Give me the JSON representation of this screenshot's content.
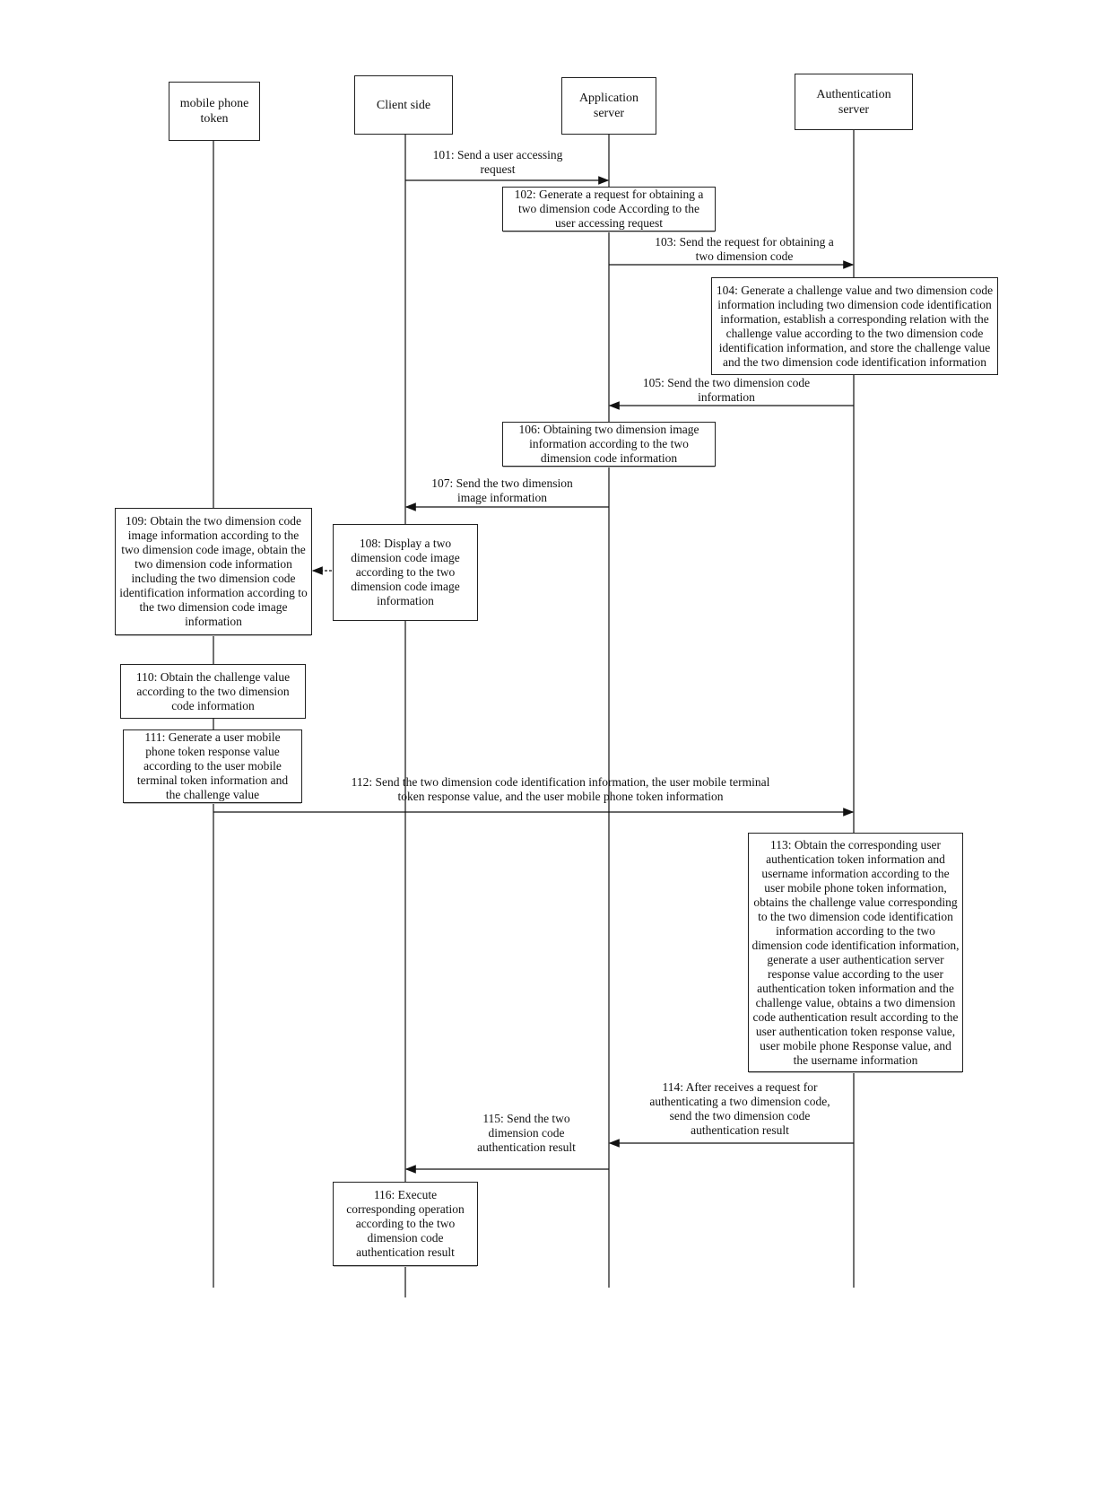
{
  "actors": [
    {
      "id": "token",
      "label": "mobile phone token"
    },
    {
      "id": "client",
      "label": "Client side"
    },
    {
      "id": "app",
      "label": "Application server"
    },
    {
      "id": "auth",
      "label": "Authentication server"
    }
  ],
  "messages": {
    "m101": "101:  Send a user accessing request",
    "m103": "103:  Send the request for obtaining a two dimension code",
    "m105": "105:  Send the two dimension code information",
    "m107": "107:  Send the two dimension image information",
    "m112": "112:  Send the two dimension code identification information, the user mobile terminal token response value, and the user mobile phone token information",
    "m114": "114:  After receives a request for authenticating a two dimension code, send the two dimension code authentication result",
    "m115": "115:  Send the two dimension code authentication result"
  },
  "steps": {
    "s102": "102:  Generate a request for obtaining a two dimension code According to the user accessing request",
    "s104": "104: Generate a challenge value and two dimension code information including two dimension code identification information, establish a corresponding relation with the challenge value according to the two dimension code identification information, and store the challenge value and the two dimension code identification information",
    "s106": "106:  Obtaining two dimension image information according to the two dimension code information",
    "s108": "108:  Display a two dimension code image according to the two dimension code image information",
    "s109": "109: Obtain the two dimension code image information according to the two dimension code image, obtain the two dimension code information including the two dimension code identification information according to the two dimension code image information",
    "s110": "110:  Obtain the challenge value according to the two dimension code information",
    "s111": "111: Generate a user mobile phone token response value according to the user mobile terminal token information and the challenge value",
    "s113": "113:  Obtain the corresponding user authentication token information and username information according to the user mobile phone token information, obtains the challenge value corresponding to the two dimension code identification information according to the two dimension code identification information, generate a user authentication server response value according to the user authentication token information and the challenge value, obtains a two dimension code authentication result  according to the user authentication token response value, user mobile  phone Response value, and the username information",
    "s116": "116:  Execute corresponding operation according to the two dimension code authentication result"
  }
}
